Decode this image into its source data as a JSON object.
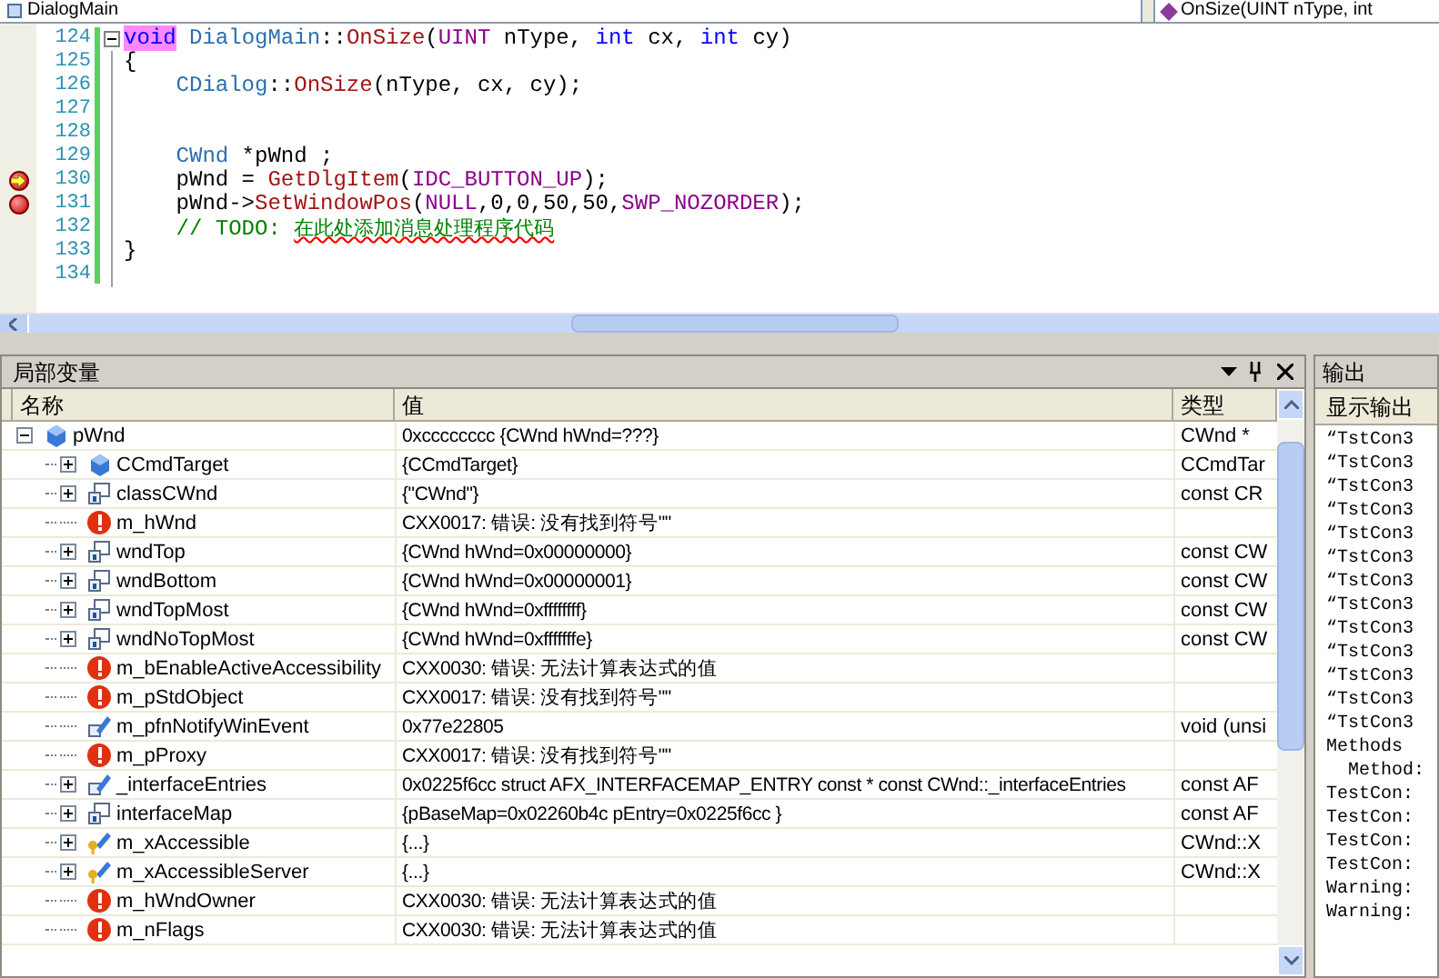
{
  "top_bar": {
    "class_combo": "DialogMain",
    "member_combo": "OnSize(UINT nType, int"
  },
  "editor": {
    "lines": [
      {
        "number": "124",
        "fold": true,
        "breakpoint": false,
        "current": false,
        "tokens": [
          {
            "kind": "keyword",
            "text": "void",
            "highlighted": true
          },
          {
            "kind": "class",
            "text": " DialogMain"
          },
          {
            "kind": "plain",
            "text": "::"
          },
          {
            "kind": "func",
            "text": "OnSize"
          },
          {
            "kind": "plain",
            "text": "("
          },
          {
            "kind": "macro",
            "text": "UINT"
          },
          {
            "kind": "plain",
            "text": " nType, "
          },
          {
            "kind": "keyword",
            "text": "int"
          },
          {
            "kind": "plain",
            "text": " cx, "
          },
          {
            "kind": "keyword",
            "text": "int"
          },
          {
            "kind": "plain",
            "text": " cy)"
          }
        ]
      },
      {
        "number": "125",
        "fold": false,
        "breakpoint": false,
        "current": false,
        "tokens": [
          {
            "kind": "plain",
            "text": "{"
          }
        ]
      },
      {
        "number": "126",
        "fold": false,
        "breakpoint": false,
        "current": false,
        "tokens": [
          {
            "kind": "class",
            "text": "    CDialog"
          },
          {
            "kind": "plain",
            "text": "::"
          },
          {
            "kind": "func",
            "text": "OnSize"
          },
          {
            "kind": "plain",
            "text": "(nType, cx, cy);"
          }
        ]
      },
      {
        "number": "127",
        "fold": false,
        "breakpoint": false,
        "current": false
      },
      {
        "number": "128",
        "fold": false,
        "breakpoint": false,
        "current": false
      },
      {
        "number": "129",
        "fold": false,
        "breakpoint": false,
        "current": false,
        "tokens": [
          {
            "kind": "class",
            "text": "    CWnd"
          },
          {
            "kind": "plain",
            "text": " *pWnd ;"
          }
        ]
      },
      {
        "number": "130",
        "fold": false,
        "breakpoint": true,
        "current": true,
        "tokens": [
          {
            "kind": "plain",
            "text": "    pWnd = "
          },
          {
            "kind": "func",
            "text": "GetDlgItem"
          },
          {
            "kind": "plain",
            "text": "("
          },
          {
            "kind": "macro",
            "text": "IDC_BUTTON_UP"
          },
          {
            "kind": "plain",
            "text": ");"
          }
        ]
      },
      {
        "number": "131",
        "fold": false,
        "breakpoint": true,
        "current": false,
        "tokens": [
          {
            "kind": "plain",
            "text": "    pWnd->"
          },
          {
            "kind": "func",
            "text": "SetWindowPos"
          },
          {
            "kind": "plain",
            "text": "("
          },
          {
            "kind": "macro",
            "text": "NULL"
          },
          {
            "kind": "plain",
            "text": ",0,0,50,50,"
          },
          {
            "kind": "macro",
            "text": "SWP_NOZORDER"
          },
          {
            "kind": "plain",
            "text": ");"
          }
        ]
      },
      {
        "number": "132",
        "fold": false,
        "breakpoint": false,
        "current": false,
        "tokens": [
          {
            "kind": "comment",
            "text": "    // TODO: "
          },
          {
            "kind": "comment",
            "text": "在此处添加消息处理程序代码",
            "squiggly": true
          }
        ]
      },
      {
        "number": "133",
        "fold": false,
        "breakpoint": false,
        "current": false,
        "tokens": [
          {
            "kind": "plain",
            "text": "}"
          }
        ]
      },
      {
        "number": "134",
        "fold": false,
        "breakpoint": false,
        "current": false
      }
    ]
  },
  "locals": {
    "title": "局部变量",
    "columns": [
      "名称",
      "值",
      "类型"
    ],
    "rows": [
      {
        "name": "pWnd",
        "kind": "object",
        "expanded": true,
        "value": "0xcccccccc {CWnd hWnd=???}",
        "type": "CWnd *",
        "children": [
          {
            "name": "CCmdTarget",
            "kind": "object",
            "expanded": false,
            "value": "{CCmdTarget}",
            "type": "CCmdTar"
          },
          {
            "name": "classCWnd",
            "kind": "static",
            "expanded": false,
            "value": "{\"CWnd\"}",
            "type": "const CR"
          },
          {
            "name": "m_hWnd",
            "kind": "error",
            "value": "CXX0017: 错误: 没有找到符号\"\""
          },
          {
            "name": "wndTop",
            "kind": "static",
            "expanded": false,
            "value": "{CWnd hWnd=0x00000000}",
            "type": "const CW"
          },
          {
            "name": "wndBottom",
            "kind": "static",
            "expanded": false,
            "value": "{CWnd hWnd=0x00000001}",
            "type": "const CW"
          },
          {
            "name": "wndTopMost",
            "kind": "static",
            "expanded": false,
            "value": "{CWnd hWnd=0xffffffff}",
            "type": "const CW"
          },
          {
            "name": "wndNoTopMost",
            "kind": "static",
            "expanded": false,
            "value": "{CWnd hWnd=0xfffffffe}",
            "type": "const CW"
          },
          {
            "name": "m_bEnableActiveAccessibility",
            "kind": "error",
            "value": "CXX0030: 错误: 无法计算表达式的值"
          },
          {
            "name": "m_pStdObject",
            "kind": "error",
            "value": "CXX0017: 错误: 没有找到符号\"\""
          },
          {
            "name": "m_pfnNotifyWinEvent",
            "kind": "method",
            "value": "0x77e22805",
            "type": "void (unsi"
          },
          {
            "name": "m_pProxy",
            "kind": "error",
            "value": "CXX0017: 错误: 没有找到符号\"\""
          },
          {
            "name": "_interfaceEntries",
            "kind": "method",
            "expanded": false,
            "value": "0x0225f6cc struct AFX_INTERFACEMAP_ENTRY const * const CWnd::_interfaceEntries",
            "type": "const AF"
          },
          {
            "name": "interfaceMap",
            "kind": "static",
            "expanded": false,
            "value": "{pBaseMap=0x02260b4c pEntry=0x0225f6cc }",
            "type": "const AF"
          },
          {
            "name": "m_xAccessible",
            "kind": "protected",
            "expanded": false,
            "value": "{...}",
            "type": "CWnd::X"
          },
          {
            "name": "m_xAccessibleServer",
            "kind": "protected",
            "expanded": false,
            "value": "{...}",
            "type": "CWnd::X"
          },
          {
            "name": "m_hWndOwner",
            "kind": "error",
            "value": "CXX0030: 错误: 无法计算表达式的值"
          },
          {
            "name": "m_nFlags",
            "kind": "error",
            "value": "CXX0030: 错误: 无法计算表达式的值"
          }
        ]
      }
    ]
  },
  "output": {
    "title": "输出",
    "source_label": "显示输出",
    "lines": [
      {
        "text": "“TstCon3"
      },
      {
        "text": "“TstCon3"
      },
      {
        "text": "“TstCon3"
      },
      {
        "text": "“TstCon3"
      },
      {
        "text": "“TstCon3"
      },
      {
        "text": "“TstCon3"
      },
      {
        "text": "“TstCon3"
      },
      {
        "text": "“TstCon3"
      },
      {
        "text": "“TstCon3"
      },
      {
        "text": "“TstCon3"
      },
      {
        "text": "“TstCon3"
      },
      {
        "text": "“TstCon3"
      },
      {
        "text": "“TstCon3"
      },
      {
        "text": "Methods"
      },
      {
        "text": "  Method:"
      },
      {
        "text": "TestCon:"
      },
      {
        "text": "TestCon:"
      },
      {
        "text": "TestCon:"
      },
      {
        "text": "TestCon:"
      },
      {
        "text": "Warning:"
      },
      {
        "text": "Warning:"
      }
    ]
  }
}
